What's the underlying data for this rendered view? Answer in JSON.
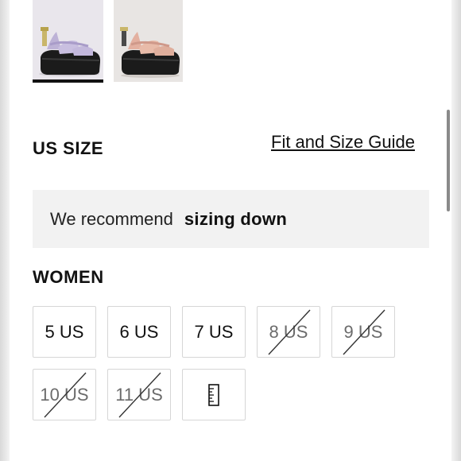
{
  "header": {
    "us_size_title": "US SIZE",
    "fit_guide_link": "Fit and Size Guide"
  },
  "recommendation": {
    "prefix": "We recommend",
    "emphasis": "sizing down"
  },
  "women": {
    "title": "WOMEN",
    "sizes": [
      {
        "label": "5 US",
        "available": true
      },
      {
        "label": "6 US",
        "available": true
      },
      {
        "label": "7 US",
        "available": true
      },
      {
        "label": "8 US",
        "available": false
      },
      {
        "label": "9 US",
        "available": false
      },
      {
        "label": "10 US",
        "available": false
      },
      {
        "label": "11 US",
        "available": false
      }
    ],
    "guide_icon": "ruler-icon"
  },
  "thumbnails": [
    {
      "name": "lilac-sandal-thumbnail",
      "selected": true
    },
    {
      "name": "peach-sandal-thumbnail",
      "selected": false
    }
  ],
  "colors": {
    "accent": "#111111",
    "recommend_bg": "#f2f2f2",
    "border": "#d6d6d6"
  }
}
